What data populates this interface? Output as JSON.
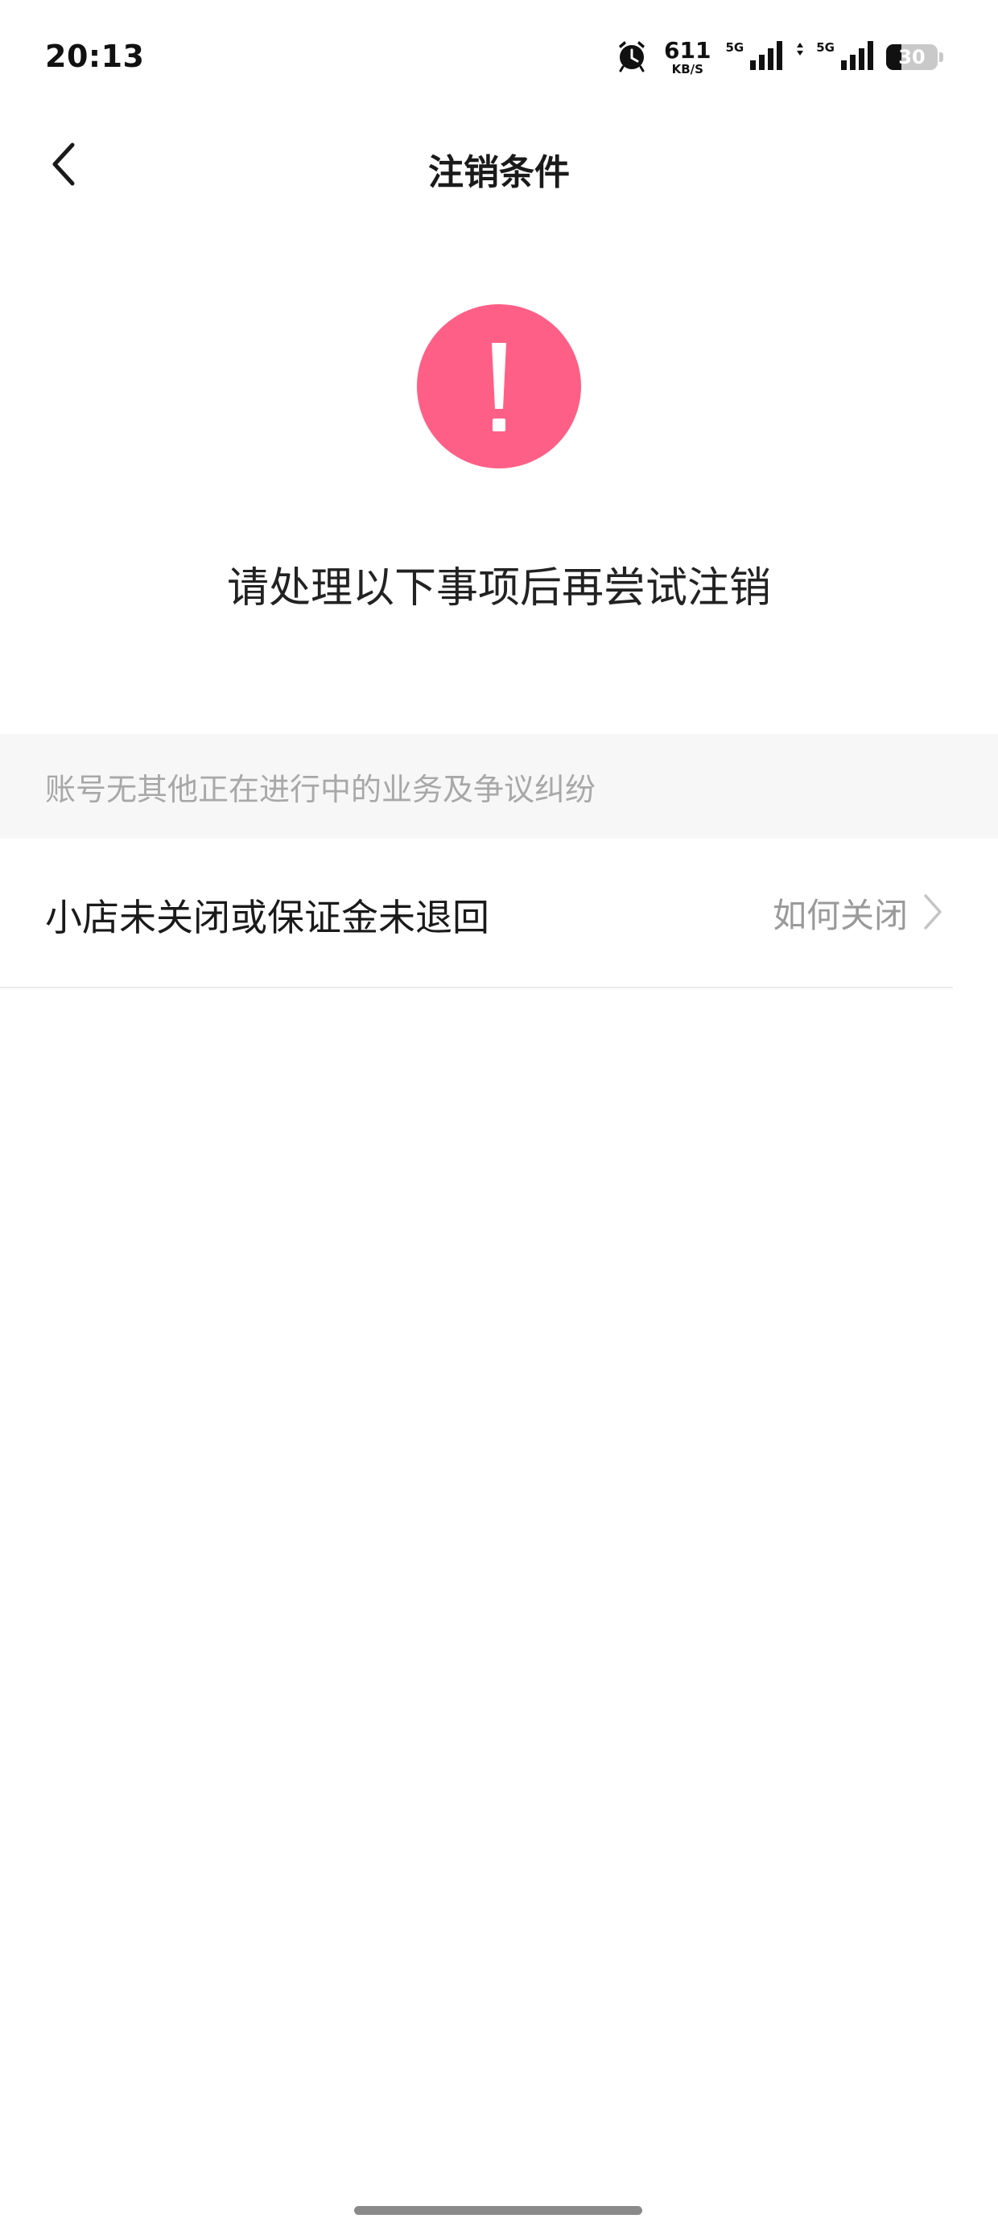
{
  "status_bar": {
    "time": "20:13",
    "net_speed_value": "611",
    "net_speed_unit": "KB/S",
    "signal1_label": "5G",
    "signal2_label": "5G",
    "battery_level": "30",
    "battery_fraction": 0.3
  },
  "header": {
    "title": "注销条件"
  },
  "notice": {
    "message": "请处理以下事项后再尝试注销",
    "icon_color": "#fe5f86"
  },
  "section": {
    "header": "账号无其他正在进行中的业务及争议纠纷"
  },
  "conditions": [
    {
      "label": "小店未关闭或保证金未退回",
      "action": "如何关闭"
    }
  ]
}
